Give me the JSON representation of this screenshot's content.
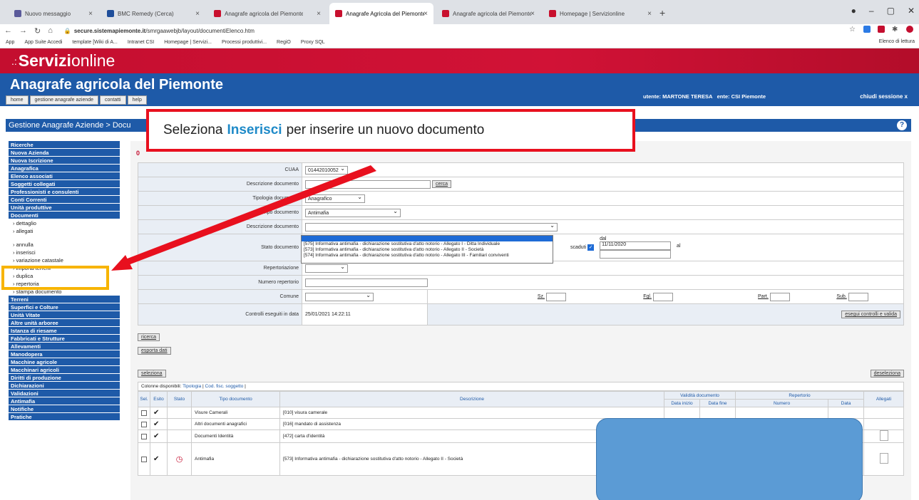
{
  "browser": {
    "tabs": [
      {
        "label": "Nuovo messaggio",
        "fav": "gray"
      },
      {
        "label": "BMC Remedy (Cerca)",
        "fav": "blue"
      },
      {
        "label": "Anagrafe agricola del Piemonte",
        "fav": "red"
      },
      {
        "label": "Anagrafe Agricola del Piemonte",
        "fav": "red",
        "active": true
      },
      {
        "label": "Anagrafe agricola del Piemonte",
        "fav": "red"
      },
      {
        "label": "Homepage | Servizionline",
        "fav": "red"
      }
    ],
    "url_host": "secure.sistemapiemonte.it",
    "url_path": "/smrgaawebjb/layout/documentiElenco.htm",
    "bookmarks": [
      "App",
      "App Suite Accedi",
      "template [Wiki di A...",
      "Intranet CSI",
      "Homepage | Servizi...",
      "Processi produttivi...",
      "RegiO",
      "Proxy SQL"
    ],
    "reading_list": "Elenco di lettura"
  },
  "header": {
    "brand_bold": "Servizi",
    "brand_light": "online",
    "app_title": "Anagrafe agricola del Piemonte",
    "nav": [
      "home",
      "gestione anagrafe aziende",
      "contatti",
      "help"
    ],
    "user_label": "utente: MARTONE TERESA",
    "ente_label": "ente: CSI Piemonte",
    "logout": "chiudi sessione  x",
    "breadcrumb": "Gestione Anagrafe Aziende > Docu"
  },
  "sidebar": {
    "sections": [
      {
        "items": [
          {
            "t": "Ricerche",
            "h": true
          },
          {
            "t": "Nuova Azienda",
            "h": true
          },
          {
            "t": "Nuova Iscrizione",
            "h": true
          }
        ]
      },
      {
        "items": [
          {
            "t": "Anagrafica",
            "h": true
          },
          {
            "t": "Elenco associati",
            "h": true
          },
          {
            "t": "Soggetti collegati",
            "h": true
          },
          {
            "t": "Professionisti e consulenti",
            "h": true
          },
          {
            "t": "Conti Correnti",
            "h": true
          },
          {
            "t": "Unità produttive",
            "h": true
          },
          {
            "t": "Documenti",
            "h": true
          },
          {
            "t": "› dettaglio",
            "h": false
          },
          {
            "t": "› allegati",
            "h": false
          }
        ]
      },
      {
        "items": [
          {
            "t": "› annulla",
            "h": false
          },
          {
            "t": "› inserisci",
            "h": false
          },
          {
            "t": "› variazione catastale",
            "h": false
          },
          {
            "t": "› importa terreni",
            "h": false
          },
          {
            "t": "› duplica",
            "h": false
          },
          {
            "t": "› repertoria",
            "h": false
          },
          {
            "t": "› stampa documento",
            "h": false
          },
          {
            "t": "Terreni",
            "h": true
          },
          {
            "t": "Superfici e Colture",
            "h": true
          },
          {
            "t": "Unità Vitate",
            "h": true
          },
          {
            "t": "Altre unità arboree",
            "h": true
          },
          {
            "t": "Istanza di riesame",
            "h": true
          },
          {
            "t": "Fabbricati e Strutture",
            "h": true
          },
          {
            "t": "Allevamenti",
            "h": true
          },
          {
            "t": "Manodopera",
            "h": true
          },
          {
            "t": "Macchine agricole",
            "h": true
          },
          {
            "t": "Macchinari agricoli",
            "h": true
          },
          {
            "t": "Diritti di produzione",
            "h": true
          },
          {
            "t": "Dichiarazioni",
            "h": true
          },
          {
            "t": "Validazioni",
            "h": true
          },
          {
            "t": "Antimafia",
            "h": true
          },
          {
            "t": "Notifiche",
            "h": true
          },
          {
            "t": "Pratiche",
            "h": true
          }
        ]
      }
    ]
  },
  "filter": {
    "cuaa_label": "CUAA",
    "cuaa_value": "01442010052",
    "desc_label": "Descrizione documento",
    "cerca": "cerca",
    "tipologia_label": "Tipologia documento",
    "tipologia_value": "Anagrafico",
    "tipo_label": "Tipo documento",
    "tipo_value": "Antimafia",
    "descdoc_label": "Descrizione documento",
    "stato_label": "Stato documento",
    "scaduti": "scaduti",
    "dal": "dal",
    "dal_value": "11/11/2020",
    "al": "al",
    "repert_label": "Repertoriazione",
    "numrep_label": "Numero repertorio",
    "comune_label": "Comune",
    "sz": "Sz.",
    "fgl": "Fgl.",
    "part": "Part.",
    "sub": "Sub.",
    "controlli_label": "Controlli eseguiti in data",
    "controlli_value": "25/01/2021 14:22:11",
    "esegui": "esegui controlli e valida"
  },
  "dropdown": [
    "",
    "[575] Informativa antimafia - dichiarazione sostitutiva d'atto notorio - Allegato I - Ditta Individuale",
    "[573] Informativa antimafia - dichiarazione sostitutiva d'atto notorio - Allegato II - Società",
    "[574] Informativa antimafia - dichiarazione sostitutiva d'atto notorio - Allegato III - Familiari conviventi"
  ],
  "buttons": {
    "ricerca": "ricerca",
    "esporta": "esporta dati",
    "seleziona": "seleziona",
    "deseleziona": "deseleziona"
  },
  "colonne": {
    "label": "Colonne disponibili:",
    "tipologia": "Tipologia",
    "codfisc": "Cod. fisc. soggetto"
  },
  "grid": {
    "headers": {
      "sel": "Sel.",
      "esito": "Esito",
      "stato": "Stato",
      "tipo": "Tipo documento",
      "desc": "Descrizione",
      "validita": "Validità documento",
      "repertorio": "Repertorio",
      "allegati": "Allegati",
      "data_inizio": "Data inizio",
      "data_fine": "Data fine",
      "numero": "Numero",
      "data": "Data"
    },
    "rows": [
      {
        "tipo": "Visure Camerali",
        "desc": "[010] visura camerale",
        "tall": false,
        "clock": false,
        "doc": false
      },
      {
        "tipo": "Altri documenti anagrafici",
        "desc": "[016] mandato di assistenza",
        "tall": false,
        "clock": false,
        "doc": false
      },
      {
        "tipo": "Documenti Identità",
        "desc": "[472] carta d'identità",
        "tall": false,
        "clock": false,
        "doc": true
      },
      {
        "tipo": "Antimafia",
        "desc": "[573] Informativa antimafia - dichiarazione sostitutiva d'atto notorio - Allegato II - Società",
        "tall": true,
        "clock": true,
        "doc": true
      }
    ]
  },
  "callout": {
    "pre": "Seleziona",
    "em": "Inserisci",
    "post": "per inserire un nuovo documento"
  }
}
